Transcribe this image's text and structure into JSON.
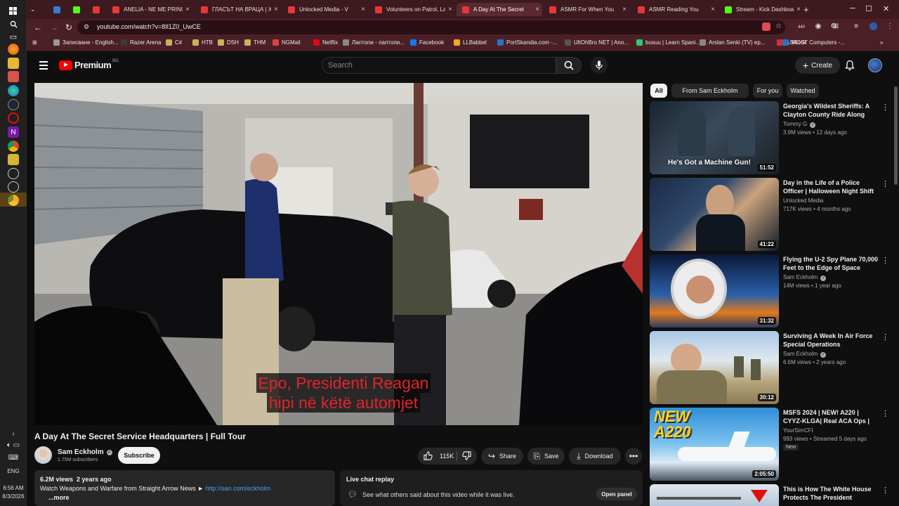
{
  "taskbar": {
    "lang": "ENG",
    "time": "6:56 AM",
    "date": "8/3/2026"
  },
  "browser": {
    "tabs": [
      {
        "title": "ANELIA - NE ME PRINU",
        "color": "#e53935"
      },
      {
        "title": "ГЛАСЪТ НА ВРАЦА | Хл",
        "color": "#e53935"
      },
      {
        "title": "Unlocked Media - V",
        "color": "#e53935"
      },
      {
        "title": "Volunteers on Patrol, La",
        "color": "#e53935"
      },
      {
        "title": "A Day At The Secret",
        "color": "#e53935"
      },
      {
        "title": "ASMR For When You",
        "color": "#e53935"
      },
      {
        "title": "ASMR Reading You",
        "color": "#e53935"
      },
      {
        "title": "Stream - Kick Dashboa",
        "color": "#53fc18"
      }
    ],
    "url": "youtube.com/watch?v=8Il1Z0_UwCE",
    "ext_badge": "440",
    "bookmarks": [
      "Записване - English...",
      "Razer Arena",
      "C#",
      "HTB",
      "DSH",
      "THM",
      "NGMail",
      "Netflix",
      "Лаптопи - лаптопи...",
      "Facebook",
      "LLBabbel",
      "PortSkandia.com -...",
      "UltOhBro NET | Ano...",
      "busuu | Learn Spani...",
      "Arslan Senki (TV) ep...",
      "ASRock",
      "MOST Computers -..."
    ]
  },
  "youtube": {
    "logo_text": "Premium",
    "logo_region": "BG",
    "search_placeholder": "Search",
    "create_label": "Create",
    "video": {
      "title": "A Day At The Secret Service Headquarters | Full Tour",
      "caption_line1": "Epo, Presidenti Reagan",
      "caption_line2": "hipi në këtë automjet",
      "channel": "Sam Eckholm",
      "subscribers": "1.75M subscribers",
      "subscribe_label": "Subscribe",
      "likes": "115K",
      "share_label": "Share",
      "save_label": "Save",
      "download_label": "Download",
      "views": "6.2M views",
      "age": "2 years ago",
      "description_line": "Watch Weapons and Warfare from Straight Arrow News ►",
      "description_link": "http://san.com/eckholm",
      "more_label": "...more"
    },
    "chat": {
      "title": "Live chat replay",
      "subtitle": "See what others said about this video while it was live.",
      "open_label": "Open panel"
    },
    "chips": [
      "All",
      "From Sam Eckholm",
      "For you",
      "Watched"
    ],
    "recommendations": [
      {
        "title": "Georgia's Wildest Sheriffs: A Clayton County Ride Along",
        "channel": "Tommy G",
        "meta": "3.9M views • 12 days ago",
        "duration": "51:52",
        "thumb_text": "He's Got a Machine Gun!",
        "verified": true
      },
      {
        "title": "Day in the Life of a Police Officer | Halloween Night Shift (12 ...",
        "channel": "Unlocked Media",
        "meta": "717K views • 4 months ago",
        "duration": "41:22",
        "thumb_text": "",
        "verified": false
      },
      {
        "title": "Flying the U-2 Spy Plane 70,000 Feet to the Edge of Space",
        "channel": "Sam Eckholm",
        "meta": "14M views • 1 year ago",
        "duration": "31:32",
        "thumb_text": "",
        "verified": true
      },
      {
        "title": "Surviving A Week In Air Force Special Operations",
        "channel": "Sam Eckholm",
        "meta": "6.6M views • 2 years ago",
        "duration": "30:12",
        "thumb_text": "",
        "verified": true
      },
      {
        "title": "MSFS 2024 | NEW! A220 | CYYZ-KLGA| Real ACA Ops | Real Airli...",
        "channel": "YourSimCFI",
        "meta": "993 views • Streamed 5 days ago",
        "duration": "2:05:50",
        "thumb_text": "NEW A220",
        "badge": "New",
        "verified": false
      },
      {
        "title": "This is How The White House Protects The President",
        "channel": "Sam Eckholm",
        "meta": "",
        "duration": "",
        "thumb_text": "",
        "verified": true
      }
    ]
  }
}
